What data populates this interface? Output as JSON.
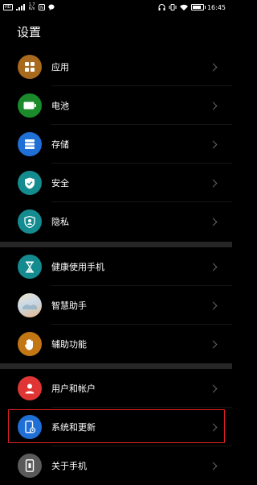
{
  "status_bar": {
    "left_badge": "HD",
    "net_speed_top": "1.7",
    "net_speed_bottom": "K/s",
    "time": "16:45",
    "battery_level": 0.85
  },
  "title": "设置",
  "groups": [
    {
      "items": [
        {
          "label": "应用",
          "icon": "apps-icon",
          "color": "#a86a1c"
        },
        {
          "label": "电池",
          "icon": "battery-icon",
          "color": "#1a8a2a"
        },
        {
          "label": "存储",
          "icon": "storage-icon",
          "color": "#1f6fd6"
        },
        {
          "label": "安全",
          "icon": "shield-icon",
          "color": "#148b8f"
        },
        {
          "label": "隐私",
          "icon": "privacy-icon",
          "color": "#148b8f"
        }
      ]
    },
    {
      "items": [
        {
          "label": "健康使用手机",
          "icon": "hourglass-icon",
          "color": "#148b8f"
        },
        {
          "label": "智慧助手",
          "icon": "assistant-icon",
          "color": "#e8c090"
        },
        {
          "label": "辅助功能",
          "icon": "hand-icon",
          "color": "#c27614"
        }
      ]
    },
    {
      "items": [
        {
          "label": "用户和帐户",
          "icon": "user-icon",
          "color": "#e03535"
        },
        {
          "label": "系统和更新",
          "icon": "phone-settings-icon",
          "color": "#1f6fd6"
        },
        {
          "label": "关于手机",
          "icon": "phone-icon",
          "color": "#5a5a5a"
        }
      ]
    }
  ]
}
